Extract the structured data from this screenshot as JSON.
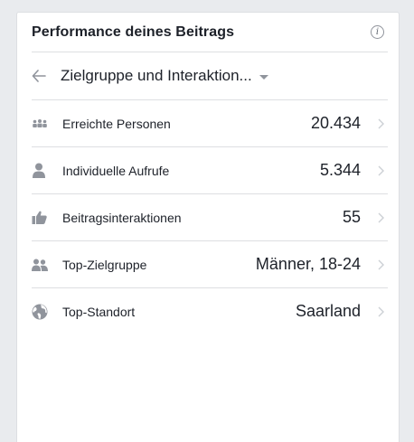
{
  "panel": {
    "title": "Performance deines Beitrags",
    "info_icon": "info-icon"
  },
  "dropdown": {
    "label": "Zielgruppe und Interaktion...",
    "back_icon": "back-arrow-icon",
    "caret_icon": "caret-down-icon"
  },
  "metrics": [
    {
      "label": "Erreichte Personen",
      "value": "20.434",
      "icon": "people-group-icon"
    },
    {
      "label": "Individuelle Aufrufe",
      "value": "5.344",
      "icon": "person-icon"
    },
    {
      "label": "Beitragsinteraktionen",
      "value": "55",
      "icon": "thumbs-up-icon"
    },
    {
      "label": "Top-Zielgruppe",
      "value": "Männer, 18-24",
      "icon": "people-pair-icon"
    },
    {
      "label": "Top-Standort",
      "value": "Saarland",
      "icon": "globe-icon"
    }
  ],
  "colors": {
    "icon_gray": "#90949c",
    "chevron_gray": "#ccd0d5",
    "divider": "#dddfe2",
    "background": "#e9ebee"
  }
}
